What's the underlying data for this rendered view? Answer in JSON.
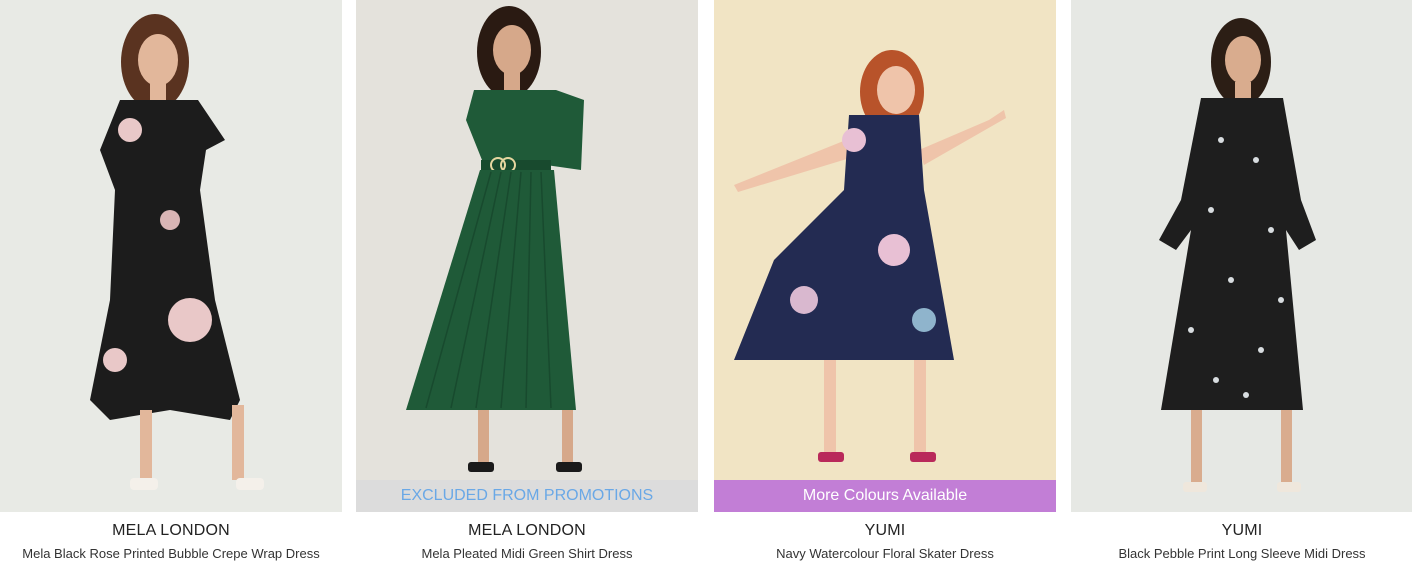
{
  "products": [
    {
      "brand": "MELA LONDON",
      "name": "Mela Black Rose Printed Bubble Crepe Wrap Dress",
      "badge": "",
      "image_icon": "model-photo",
      "colors": {
        "background": "#e8eae5",
        "dress": "#1c1c1c",
        "accent": "#e9c8c8"
      }
    },
    {
      "brand": "MELA LONDON",
      "name": "Mela Pleated Midi Green Shirt Dress",
      "badge": "EXCLUDED FROM PROMOTIONS",
      "image_icon": "model-photo",
      "colors": {
        "background": "#e4e2dc",
        "dress": "#1f5a38",
        "accent": "#e6d6a0"
      }
    },
    {
      "brand": "YUMI",
      "name": "Navy Watercolour Floral Skater Dress",
      "badge": "More Colours Available",
      "image_icon": "model-photo",
      "colors": {
        "background": "#f1e4c4",
        "dress": "#232b52",
        "accent": "#e8c0d4"
      }
    },
    {
      "brand": "YUMI",
      "name": "Black Pebble Print Long Sleeve Midi Dress",
      "badge": "",
      "image_icon": "model-photo",
      "colors": {
        "background": "#e6e8e4",
        "dress": "#1e1e1e",
        "accent": "#d8dde0"
      }
    }
  ]
}
